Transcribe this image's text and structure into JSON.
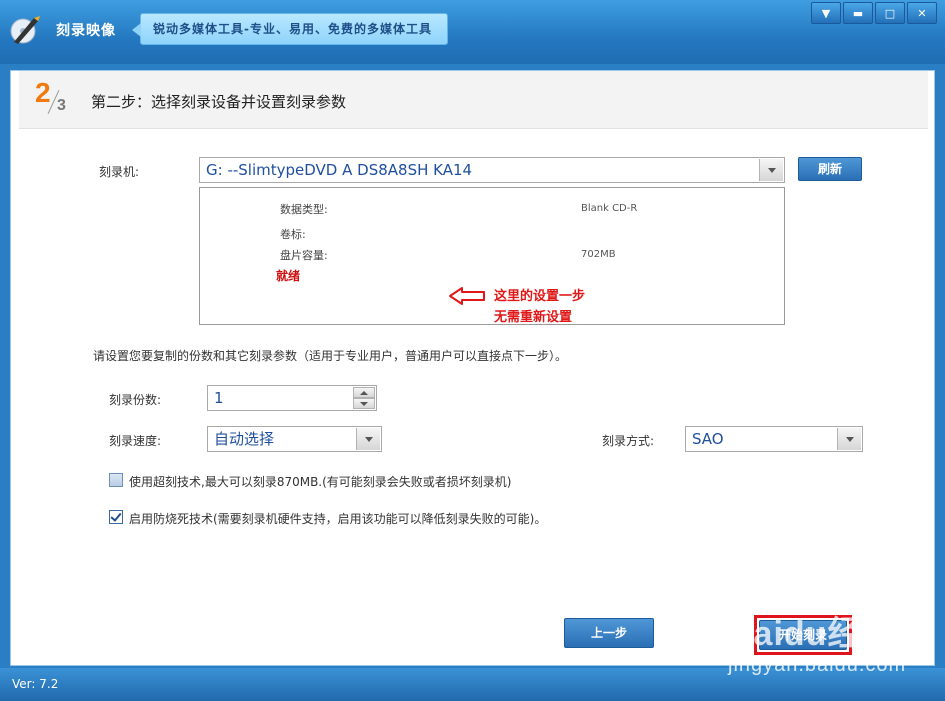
{
  "app": {
    "title": "刻录映像",
    "slogan": "锐动多媒体工具-专业、易用、免费的多媒体工具",
    "version": "Ver: 7.2",
    "window_buttons": {
      "menu": "▼",
      "minimize": "▬",
      "maximize": "□",
      "close": "✕"
    }
  },
  "step": {
    "current": "2",
    "total": "3",
    "title": "第二步：选择刻录设备并设置刻录参数"
  },
  "burner": {
    "label": "刻录机:",
    "device": "G:  --SlimtypeDVD A  DS8A8SH   KA14",
    "refresh_label": "刷新"
  },
  "disc_info": {
    "type_label": "数据类型:",
    "type_value": "Blank CD-R",
    "volume_label": "卷标:",
    "volume_value": "",
    "capacity_label": "盘片容量:",
    "capacity_value": "702MB",
    "status": "就绪"
  },
  "annotation": {
    "line1": "这里的设置一步",
    "line2": "无需重新设置"
  },
  "hint": "请设置您要复制的份数和其它刻录参数（适用于专业用户，普通用户可以直接点下一步）。",
  "params": {
    "copies_label": "刻录份数:",
    "copies_value": "1",
    "speed_label": "刻录速度:",
    "speed_value": "自动选择",
    "mode_label": "刻录方式:",
    "mode_value": "SAO"
  },
  "options": {
    "overburn_label": "使用超刻技术,最大可以刻录870MB.(有可能刻录会失败或者损坏刻录机)",
    "overburn_checked": false,
    "bufferguard_label": "启用防烧死技术(需要刻录机硬件支持，启用该功能可以降低刻录失败的可能)。",
    "bufferguard_checked": true
  },
  "buttons": {
    "prev_label": "上一步",
    "start_label": "开始刻录"
  },
  "watermark": {
    "brand": "Baidu经验",
    "url": "jingyan.baidu.com"
  },
  "colors": {
    "accent": "#2a7fc4",
    "highlight": "#e0141c",
    "step_number": "#f07a10"
  }
}
